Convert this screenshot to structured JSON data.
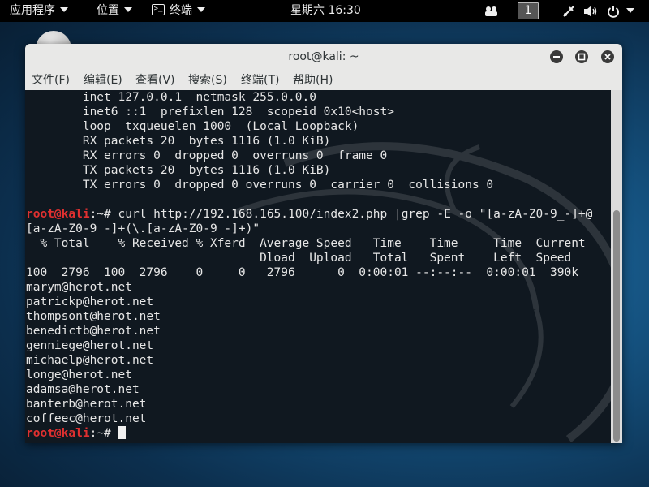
{
  "topbar": {
    "applications": "应用程序",
    "places": "位置",
    "terminal_app": "终端",
    "clock": "星期六 16:30",
    "workspace": "1",
    "icons": [
      "apps-icon",
      "network-icon",
      "volume-icon",
      "power-icon"
    ]
  },
  "window": {
    "title": "root@kali: ~",
    "buttons": [
      "minimize",
      "maximize",
      "close"
    ]
  },
  "menu": [
    {
      "label": "文件(F)"
    },
    {
      "label": "编辑(E)"
    },
    {
      "label": "查看(V)"
    },
    {
      "label": "搜索(S)"
    },
    {
      "label": "终端(T)"
    },
    {
      "label": "帮助(H)"
    }
  ],
  "terminal": {
    "lines": [
      {
        "text": "        inet 127.0.0.1  netmask 255.0.0.0"
      },
      {
        "text": "        inet6 ::1  prefixlen 128  scopeid 0x10<host>"
      },
      {
        "text": "        loop  txqueuelen 1000  (Local Loopback)"
      },
      {
        "text": "        RX packets 20  bytes 1116 (1.0 KiB)"
      },
      {
        "text": "        RX errors 0  dropped 0  overruns 0  frame 0"
      },
      {
        "text": "        TX packets 20  bytes 1116 (1.0 KiB)"
      },
      {
        "text": "        TX errors 0  dropped 0 overruns 0  carrier 0  collisions 0"
      },
      {
        "text": ""
      },
      {
        "prompt_user": "root@kali",
        "prompt_rest": ":~# ",
        "text": "curl http://192.168.165.100/index2.php |grep -E -o \"[a-zA-Z0-9_-]+@"
      },
      {
        "text": "[a-zA-Z0-9_-]+(\\.[a-zA-Z0-9_-]+)\""
      },
      {
        "text": "  % Total    % Received % Xferd  Average Speed   Time    Time     Time  Current"
      },
      {
        "text": "                                 Dload  Upload   Total   Spent    Left  Speed"
      },
      {
        "text": "100  2796  100  2796    0     0   2796      0  0:00:01 --:--:--  0:00:01  390k"
      },
      {
        "text": "marym@herot.net"
      },
      {
        "text": "patrickp@herot.net"
      },
      {
        "text": "thompsont@herot.net"
      },
      {
        "text": "benedictb@herot.net"
      },
      {
        "text": "genniege@herot.net"
      },
      {
        "text": "michaelp@herot.net"
      },
      {
        "text": "longe@herot.net"
      },
      {
        "text": "adamsa@herot.net"
      },
      {
        "text": "banterb@herot.net"
      },
      {
        "text": "coffeec@herot.net"
      },
      {
        "prompt_user": "root@kali",
        "prompt_rest": ":~# ",
        "text": "",
        "cursor": true
      }
    ]
  },
  "colors": {
    "prompt": "#e03030",
    "terminal_bg": "#101820",
    "terminal_fg": "#e6e6e6"
  }
}
